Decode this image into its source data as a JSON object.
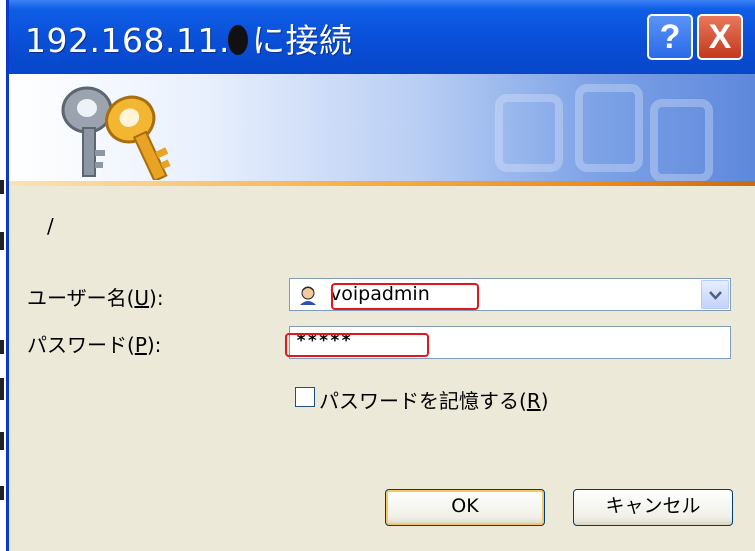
{
  "dialog": {
    "title_prefix": "192.168.11.",
    "title_suffix": "に接続",
    "help_label": "?",
    "close_label": "X",
    "realm": "/",
    "username": {
      "label_pre": "ユーザー名(",
      "label_key": "U",
      "label_post": "):",
      "value": "voipadmin"
    },
    "password": {
      "label_pre": "パスワード(",
      "label_key": "P",
      "label_post": "):",
      "value": "*****"
    },
    "remember": {
      "label_pre": "パスワードを記憶する(",
      "label_key": "R",
      "label_post": ")",
      "checked": false
    },
    "ok_label": "OK",
    "cancel_label": "キャンセル"
  },
  "colors": {
    "titlebar": "#0a4fd8",
    "highlight": "#e01818",
    "dialog_bg": "#ece9d8"
  },
  "icons": {
    "banner": "keys-icon",
    "user": "user-icon",
    "dropdown": "chevron-down-icon"
  }
}
